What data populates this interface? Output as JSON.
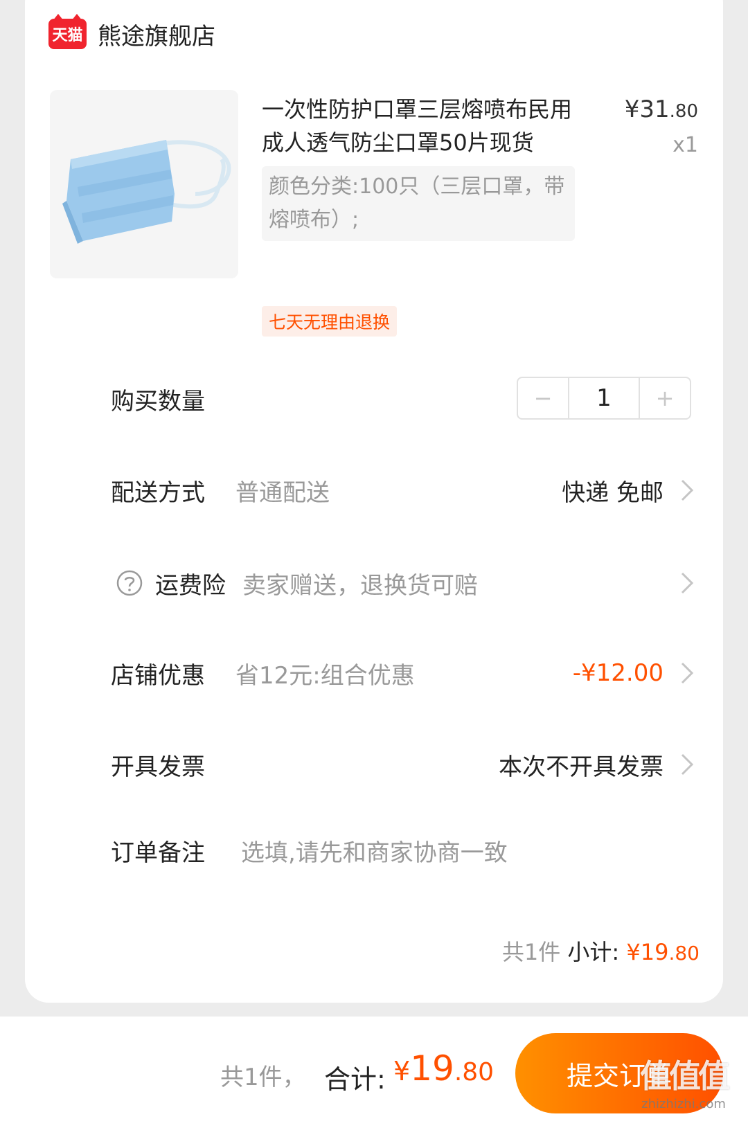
{
  "shop": {
    "logo_text": "天猫",
    "name": "熊途旗舰店"
  },
  "product": {
    "title": "一次性防护口罩三层熔喷布民用成人透气防尘口罩50片现货",
    "price_main": "¥31",
    "price_decimal": ".80",
    "quantity_badge": "x1",
    "sku": "颜色分类:100只（三层口罩，带熔喷布）;",
    "tag": "七天无理由退换",
    "image_icon": "face-mask-image"
  },
  "rows": {
    "quantity": {
      "label": "购买数量",
      "value": "1",
      "minus": "−",
      "plus": "+"
    },
    "delivery": {
      "label": "配送方式",
      "value": "普通配送",
      "right": "快递 免邮"
    },
    "insurance": {
      "label": "运费险",
      "value": "卖家赠送，退换货可赔",
      "icon": "help-circle-icon"
    },
    "discount": {
      "label": "店铺优惠",
      "value": "省12元:组合优惠",
      "right": "-¥12.00"
    },
    "invoice": {
      "label": "开具发票",
      "right": "本次不开具发票"
    },
    "remark": {
      "label": "订单备注",
      "placeholder": "选填,请先和商家协商一致"
    }
  },
  "subtotal": {
    "count": "共1件",
    "label": "小计:",
    "amount_main": "¥19",
    "amount_decimal": ".80"
  },
  "bottom": {
    "count": "共1件，",
    "label": "合计:",
    "currency": "¥",
    "amount_main": "19",
    "amount_decimal": ".80",
    "submit": "提交订单"
  },
  "watermark": {
    "main": "值值值",
    "sub": "zhizhizhi.com"
  },
  "colors": {
    "accent": "#ff5000",
    "tmall_red": "#f0242e",
    "button_gradient_start": "#ff9000",
    "button_gradient_end": "#ff5000"
  }
}
